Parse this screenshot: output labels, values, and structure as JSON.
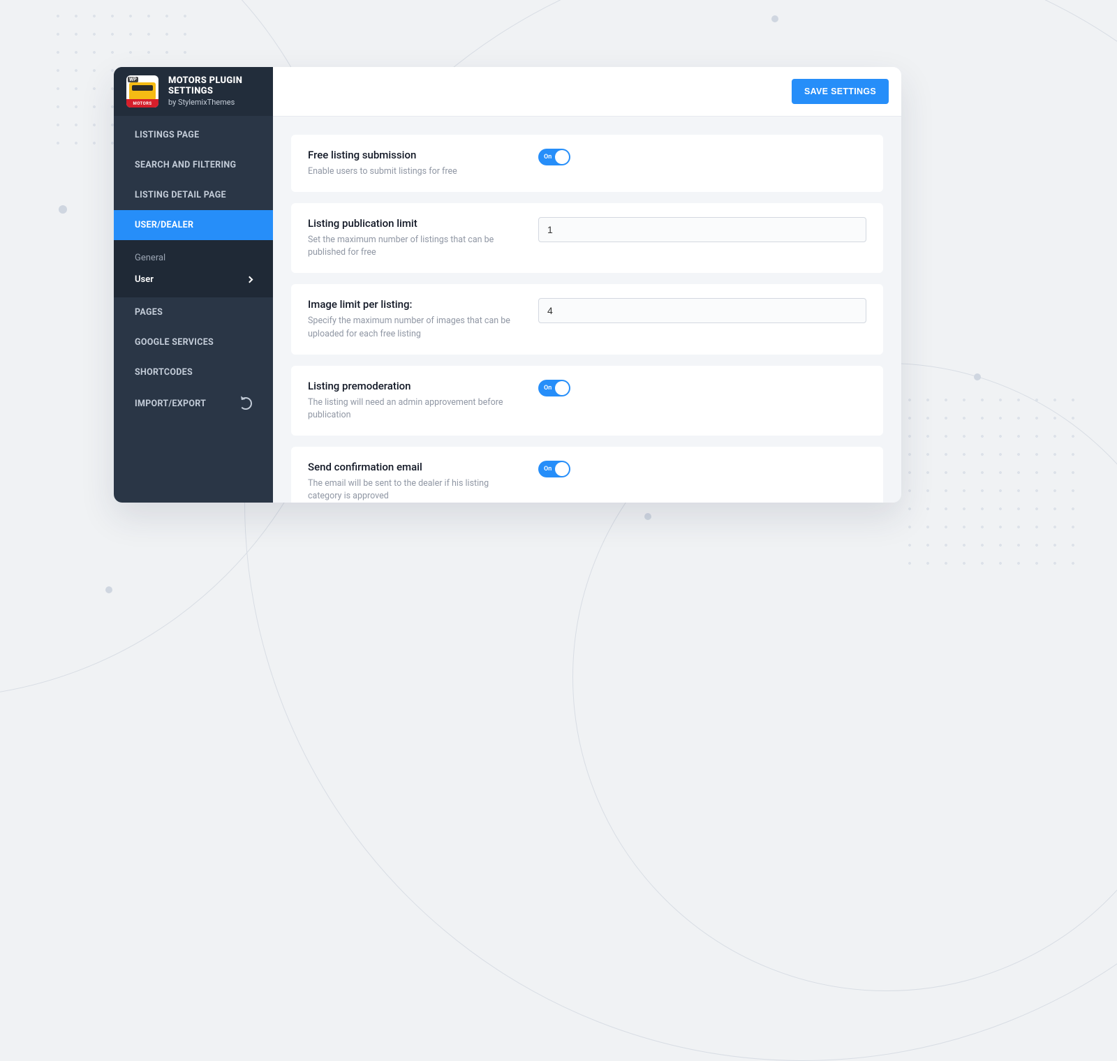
{
  "brand": {
    "title_line1": "MOTORS PLUGIN",
    "title_line2": "SETTINGS",
    "subtitle": "by StylemixThemes",
    "badge": "MOTORS"
  },
  "topbar": {
    "save_label": "SAVE SETTINGS"
  },
  "sidebar": {
    "items": [
      {
        "label": "LISTINGS PAGE"
      },
      {
        "label": "SEARCH AND FILTERING"
      },
      {
        "label": "LISTING DETAIL PAGE"
      },
      {
        "label": "USER/DEALER"
      },
      {
        "label": "PAGES"
      },
      {
        "label": "GOOGLE SERVICES"
      },
      {
        "label": "SHORTCODES"
      },
      {
        "label": "IMPORT/EXPORT"
      }
    ],
    "sub": {
      "general": "General",
      "user": "User"
    }
  },
  "settings": {
    "free_listing": {
      "title": "Free listing submission",
      "desc": "Enable users to submit listings for free",
      "toggle": "On"
    },
    "pub_limit": {
      "title": "Listing publication limit",
      "desc": "Set the maximum number of listings that can be published for free",
      "value": "1"
    },
    "image_limit": {
      "title": "Image limit per listing:",
      "desc": "Specify the maximum number of images that can be uploaded for each free listing",
      "value": "4"
    },
    "premod": {
      "title": "Listing premoderation",
      "desc": "The listing will need an admin approvement before publication",
      "toggle": "On"
    },
    "confirm_email": {
      "title": "Send confirmation email",
      "desc": "The email will be sent to the dealer if his listing category is approved",
      "toggle": "On"
    }
  }
}
